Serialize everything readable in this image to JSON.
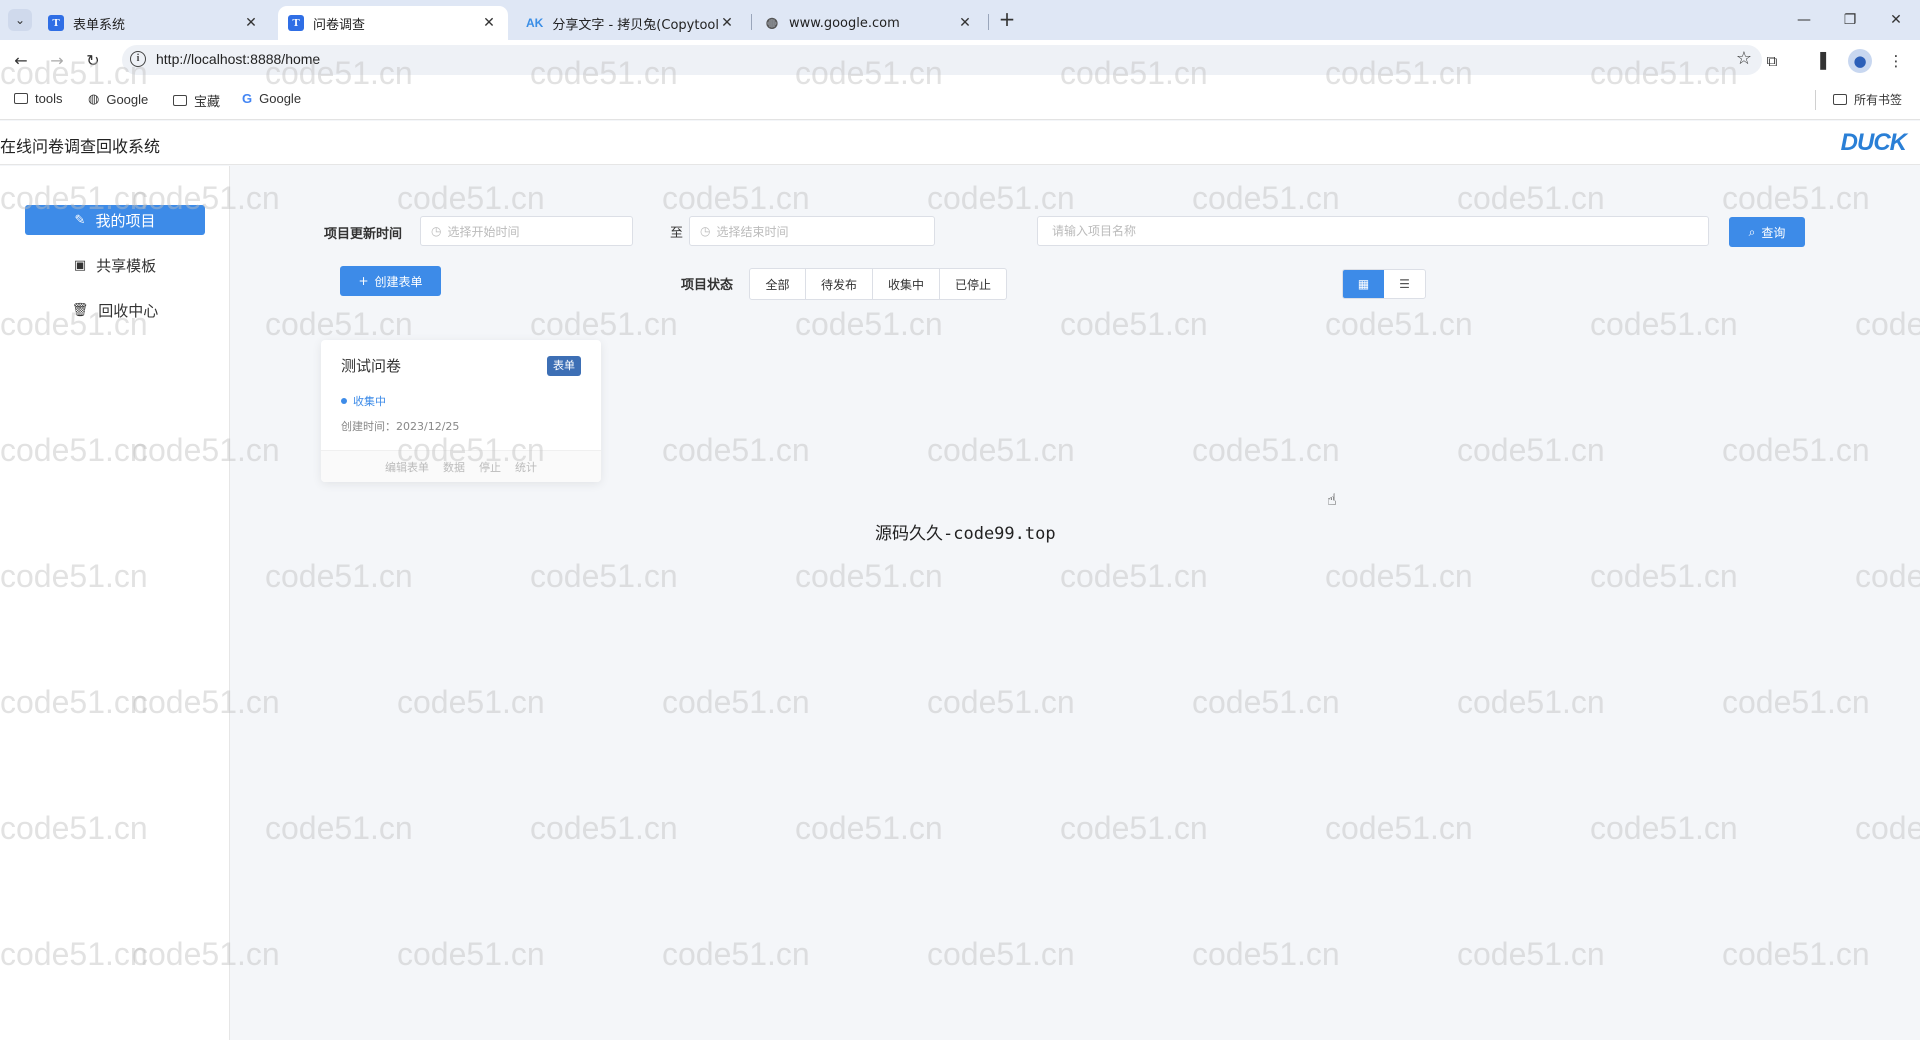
{
  "browser": {
    "tabs": [
      {
        "label": "表单系统",
        "favicon": "T"
      },
      {
        "label": "问卷调查",
        "favicon": "T",
        "active": true
      },
      {
        "label": "分享文字 - 拷贝兔(Copytool) -",
        "favicon": "AK"
      },
      {
        "label": "www.google.com",
        "favicon": "globe"
      }
    ],
    "url": "http://localhost:8888/home",
    "bookmarks": [
      {
        "label": "tools",
        "icon": "folder-icon"
      },
      {
        "label": "Google",
        "icon": "globe-icon"
      },
      {
        "label": "宝藏",
        "icon": "folder-icon"
      },
      {
        "label": "Google",
        "icon": "google-icon"
      }
    ],
    "all_bookmarks": "所有书签"
  },
  "app": {
    "title": "在线问卷调查回收系统",
    "logo": "DUCK",
    "menu": [
      {
        "label": "我的项目",
        "icon": "edit-icon",
        "active": true
      },
      {
        "label": "共享模板",
        "icon": "template-icon"
      },
      {
        "label": "回收中心",
        "icon": "trash-icon"
      }
    ]
  },
  "filters": {
    "update_time_label": "项目更新时间",
    "start_placeholder": "选择开始时间",
    "range_separator": "至",
    "end_placeholder": "选择结束时间",
    "name_placeholder": "请输入项目名称",
    "query_label": "查询",
    "create_label": "创建表单",
    "status_label": "项目状态",
    "status_options": [
      "全部",
      "待发布",
      "收集中",
      "已停止"
    ]
  },
  "projects": [
    {
      "title": "测试问卷",
      "badge": "表单",
      "status": "收集中",
      "created": "创建时间：2023/12/25",
      "actions": [
        "编辑表单",
        "数据",
        "停止",
        "统计"
      ]
    }
  ],
  "overlay": "源码久久-code99.top",
  "watermark": "code51.cn",
  "colors": {
    "accent": "#3d8be8",
    "badge": "#3d6fb5"
  }
}
